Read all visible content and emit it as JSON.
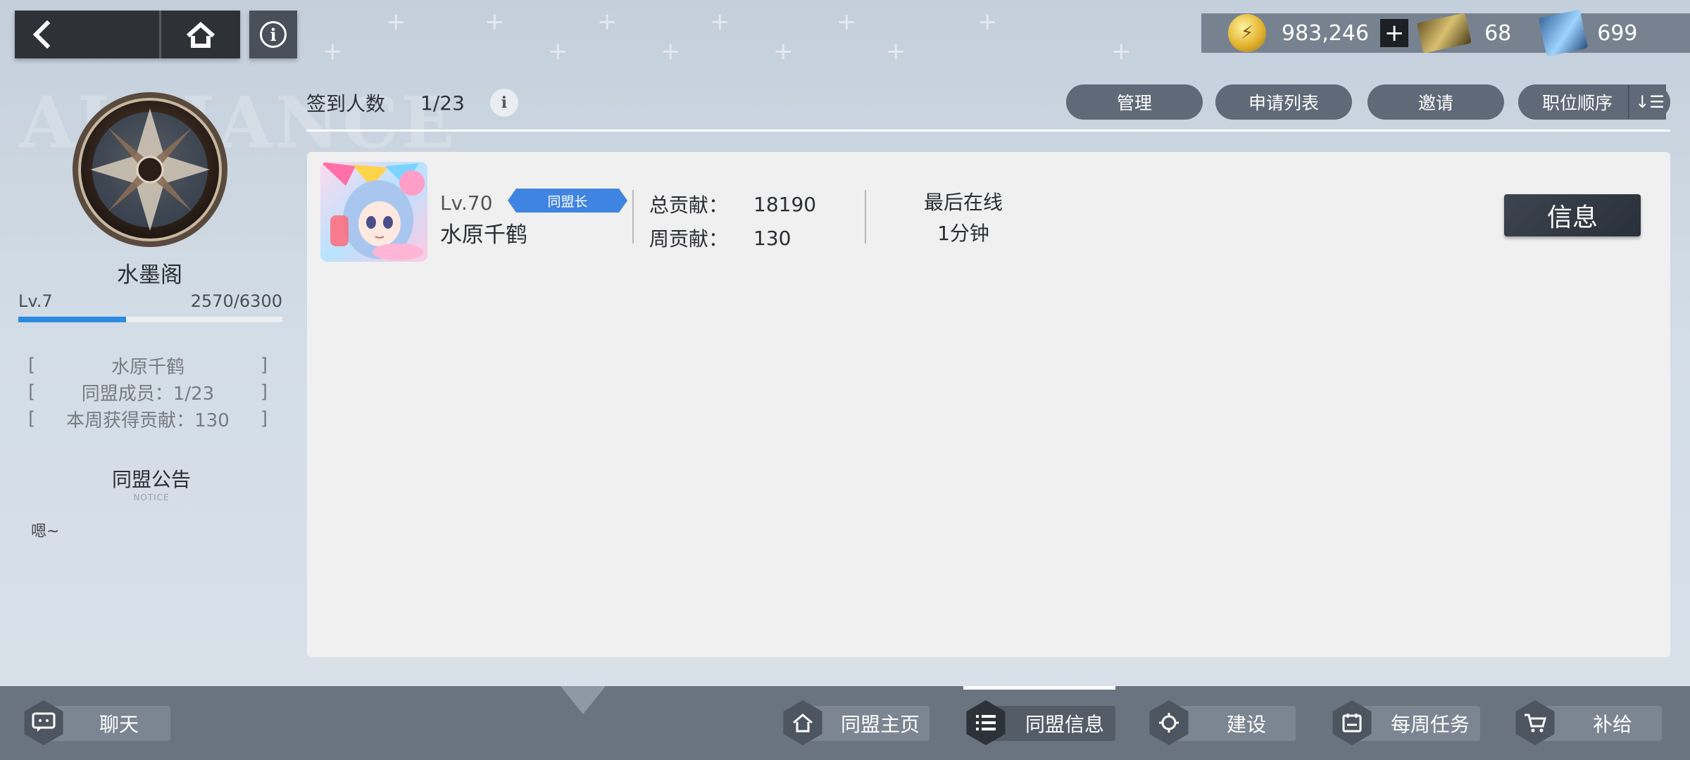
{
  "topbar": {
    "back_icon": "chevron-left-icon",
    "home_icon": "home-icon",
    "info_icon": "info-icon",
    "info_glyph": "i"
  },
  "currency": {
    "gold": "983,246",
    "gold_plus": "+",
    "tickets": "68",
    "crystals": "699"
  },
  "guild": {
    "name": "水墨阁",
    "level": "Lv.7",
    "exp": "2570/6300",
    "exp_progress": 0.408,
    "leader": "水原千鹤",
    "members": "同盟成员：1/23",
    "weekly": "本周获得贡献：130",
    "bracket_open": "[",
    "bracket_close": "]",
    "notice_title": "同盟公告",
    "notice_sub": "NOTICE",
    "notice_text": "嗯~"
  },
  "header": {
    "checkin_label": "签到人数",
    "checkin_value": "1/23",
    "info_glyph": "i",
    "buttons": [
      "管理",
      "申请列表",
      "邀请",
      "职位顺序"
    ],
    "sort_glyph": "↓☰"
  },
  "member": {
    "level": "Lv.70",
    "role": "同盟长",
    "name": "水原千鹤",
    "total_label": "总贡献：",
    "total_value": "18190",
    "weekly_label": "周贡献：",
    "weekly_value": "130",
    "online_label": "最后在线",
    "online_value": "1分钟",
    "info_button": "信息"
  },
  "bottom_nav": {
    "chat": "聊天",
    "home": "同盟主页",
    "info": "同盟信息",
    "build": "建设",
    "weekly": "每周任务",
    "supply": "补给"
  },
  "colors": {
    "accent_blue": "#3f84e0",
    "panel_dark": "#2e3136",
    "pill": "#5f6977"
  }
}
